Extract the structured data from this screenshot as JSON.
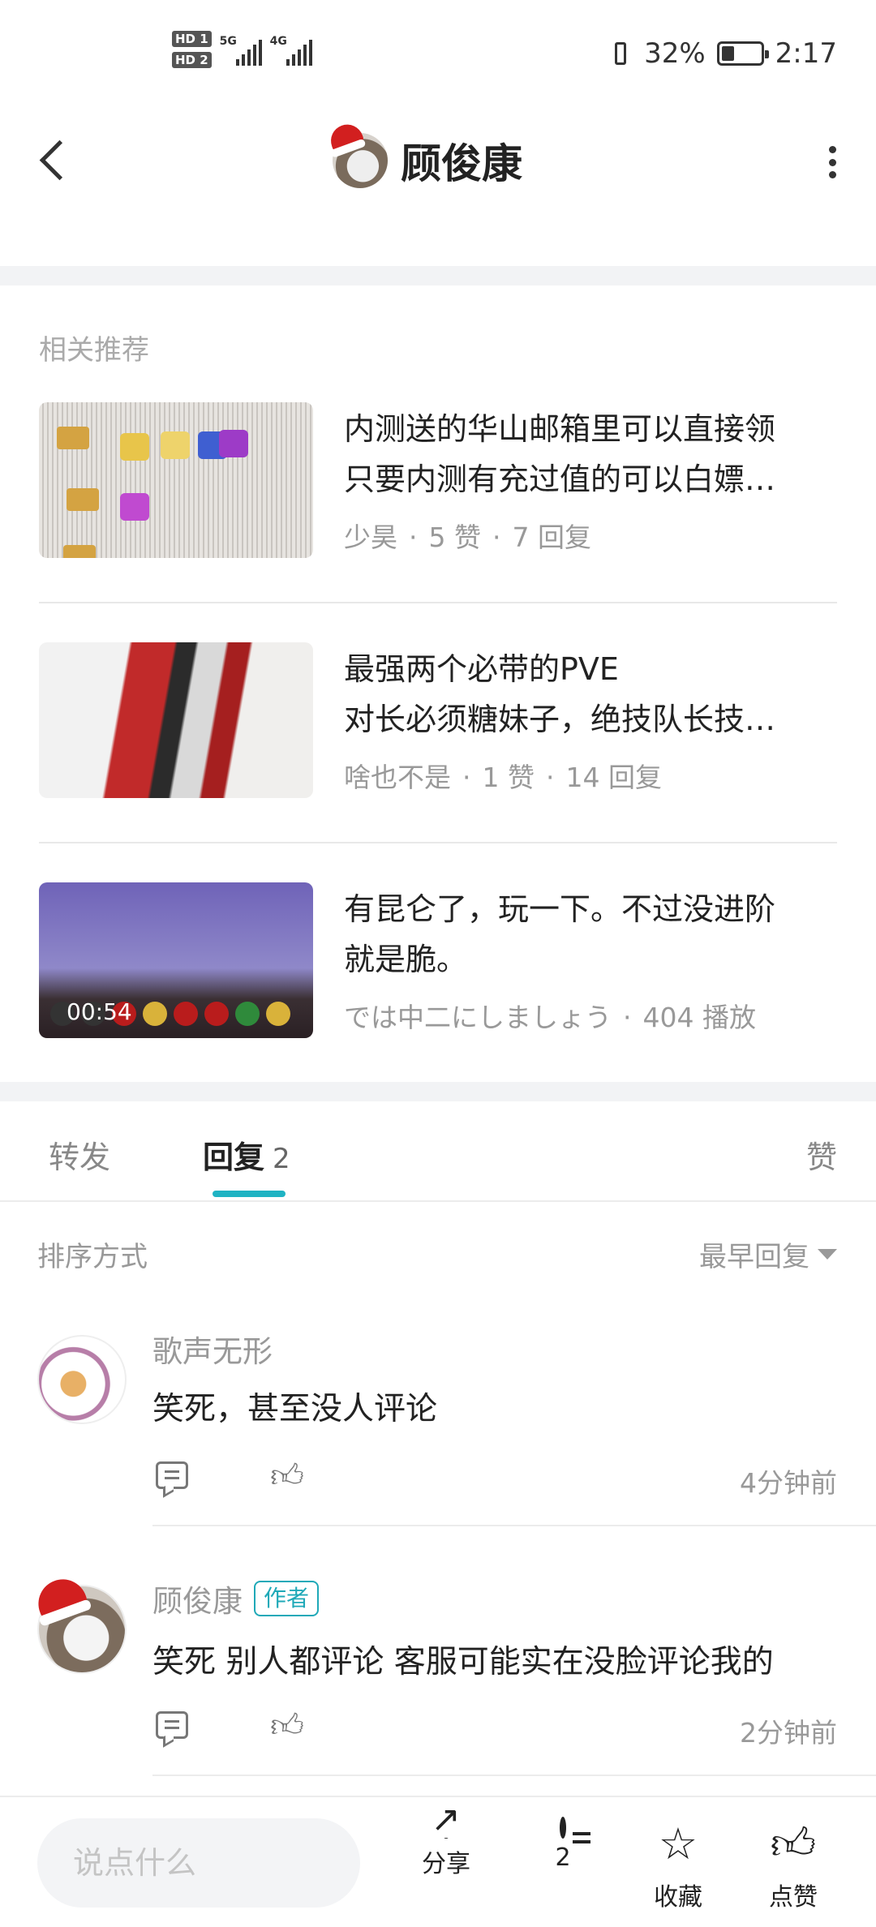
{
  "status_bar": {
    "sim1": "HD 1",
    "sim2": "HD 2",
    "net1": "5G",
    "net2": "4G",
    "battery_text": "32%",
    "battery_level": 0.32,
    "time": "2:17"
  },
  "header": {
    "title": "顾俊康"
  },
  "related": {
    "label": "相关推荐",
    "items": [
      {
        "line1": "内测送的华山邮箱里可以直接领",
        "line2": "只要内测有充过值的可以白嫖…",
        "author": "少昊",
        "likes": "5 赞",
        "replies": "7 回复"
      },
      {
        "line1": "最强两个必带的PVE",
        "line2": "对长必须糖妹子，绝技队长技…",
        "author": "啥也不是",
        "likes": "1 赞",
        "replies": "14 回复"
      },
      {
        "line1": "有昆仑了，玩一下。不过没进阶",
        "line2": "就是脆。",
        "author": "では中二にしましょう",
        "plays": "404 播放",
        "duration": "00:54"
      }
    ]
  },
  "tabs": {
    "forward": "转发",
    "reply": "回复",
    "reply_count": "2",
    "like": "赞"
  },
  "sort": {
    "label": "排序方式",
    "value": "最早回复"
  },
  "comments": [
    {
      "name": "歌声无形",
      "text": "笑死，甚至没人评论",
      "time": "4分钟前"
    },
    {
      "name": "顾俊康",
      "badge": "作者",
      "text": "笑死 别人都评论 客服可能实在没脸评论我的",
      "time": "2分钟前"
    }
  ],
  "bottom_bar": {
    "input_placeholder": "说点什么",
    "share": "分享",
    "comment_count": "2",
    "favorite": "收藏",
    "like": "点赞"
  },
  "colors": {
    "accent": "#1fb3c3",
    "text_primary": "#222222",
    "text_secondary": "#999999",
    "band": "#f2f3f5"
  }
}
